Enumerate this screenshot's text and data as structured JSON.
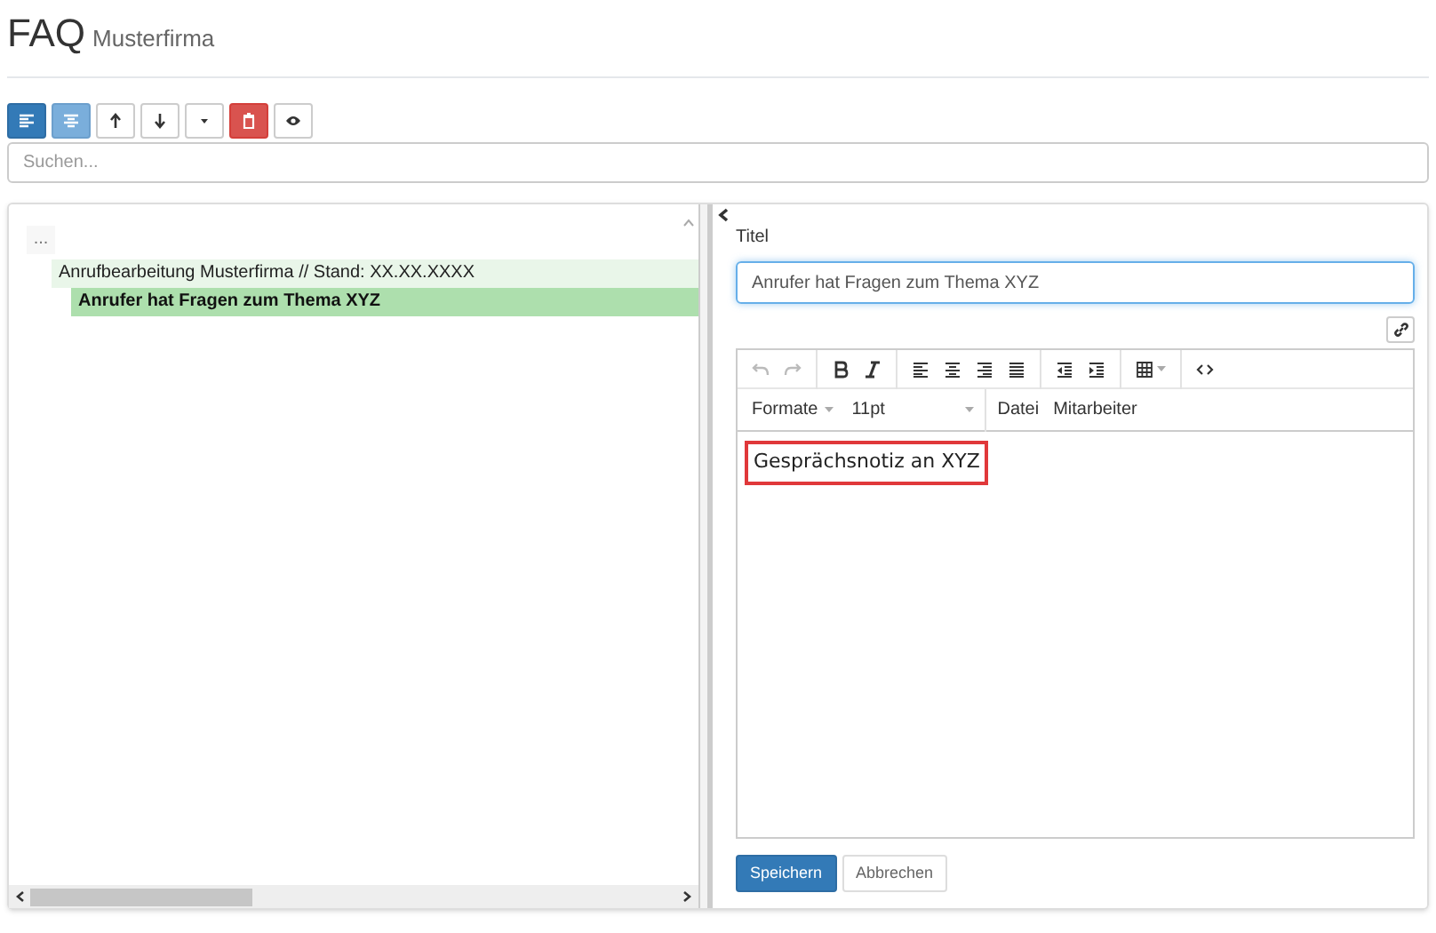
{
  "header": {
    "title": "FAQ",
    "subtitle": "Musterfirma"
  },
  "toolbar": [
    {
      "kind": "align-left"
    },
    {
      "kind": "align-center"
    },
    {
      "kind": "arrow-up"
    },
    {
      "kind": "arrow-down"
    },
    {
      "kind": "caret"
    },
    {
      "kind": "trash"
    },
    {
      "kind": "eye"
    }
  ],
  "search": {
    "placeholder": "Suchen..."
  },
  "tree": [
    {
      "label": "...",
      "selected": false,
      "children": [
        {
          "label": "Anrufbearbeitung Musterfirma // Stand: XX.XX.XXXX",
          "selected": false,
          "children": [
            {
              "label": "Anrufer hat Fragen zum Thema XYZ",
              "selected": true
            }
          ]
        }
      ]
    }
  ],
  "editor": {
    "title_label": "Titel",
    "title_value": "Anrufer hat Fragen zum Thema XYZ",
    "tools": [
      {
        "kind": "undo",
        "disabled": true
      },
      {
        "kind": "redo",
        "disabled": true
      },
      {
        "kind": "sep"
      },
      {
        "kind": "bold",
        "disabled": false
      },
      {
        "kind": "italic",
        "disabled": false
      },
      {
        "kind": "sep"
      },
      {
        "kind": "align-left",
        "disabled": false
      },
      {
        "kind": "align-center",
        "disabled": false
      },
      {
        "kind": "align-right",
        "disabled": false
      },
      {
        "kind": "justify",
        "disabled": false
      },
      {
        "kind": "sep"
      },
      {
        "kind": "outdent",
        "disabled": false
      },
      {
        "kind": "indent",
        "disabled": false
      },
      {
        "kind": "sep"
      },
      {
        "kind": "table",
        "disabled": false
      },
      {
        "kind": "sep"
      },
      {
        "kind": "code",
        "disabled": false
      }
    ],
    "menus": [
      {
        "label": "Formate",
        "kind": "dropdown"
      },
      {
        "label": "11pt",
        "kind": "size"
      },
      {
        "label": "Datei",
        "kind": "menu"
      },
      {
        "label": "Mitarbeiter",
        "kind": "menu"
      }
    ],
    "content": "Gesprächsnotiz an XYZ",
    "buttons": [
      {
        "label": "Speichern",
        "kind": "save"
      },
      {
        "label": "Abbrechen",
        "kind": "cancel"
      }
    ]
  }
}
